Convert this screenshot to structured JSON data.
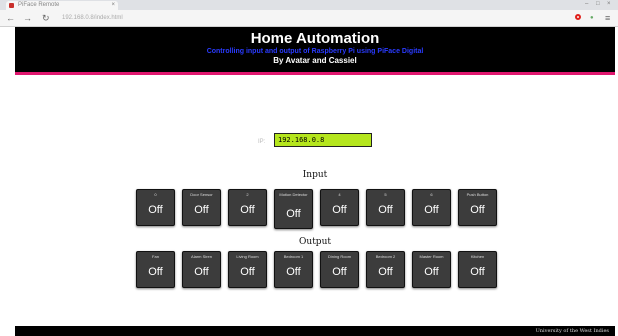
{
  "browser": {
    "tab_title": "PiFace Remote",
    "url": "192.168.0.8/index.html"
  },
  "header": {
    "title": "Home Automation",
    "subtitle": "Controlling input and output of Raspberry Pi using PiFace Digital",
    "authors": "By Avatar and Cassiel"
  },
  "ip": {
    "label": "IP:",
    "value": "192.168.0.8"
  },
  "input": {
    "heading": "Input",
    "items": [
      {
        "label": "0",
        "state": "Off"
      },
      {
        "label": "Door Sensor",
        "state": "Off"
      },
      {
        "label": "2",
        "state": "Off"
      },
      {
        "label": "Motion Detector",
        "state": "Off"
      },
      {
        "label": "4",
        "state": "Off"
      },
      {
        "label": "5",
        "state": "Off"
      },
      {
        "label": "6",
        "state": "Off"
      },
      {
        "label": "Push Button",
        "state": "Off"
      }
    ]
  },
  "output": {
    "heading": "Output",
    "items": [
      {
        "label": "Fan",
        "state": "Off"
      },
      {
        "label": "Alarm Siren",
        "state": "Off"
      },
      {
        "label": "Living Room",
        "state": "Off"
      },
      {
        "label": "Bedroom 1",
        "state": "Off"
      },
      {
        "label": "Dining Room",
        "state": "Off"
      },
      {
        "label": "Bedroom 2",
        "state": "Off"
      },
      {
        "label": "Master Room",
        "state": "Off"
      },
      {
        "label": "Kitchen",
        "state": "Off"
      }
    ]
  },
  "footer": {
    "text": "University of the West Indies"
  },
  "colors": {
    "header_bg": "#000000",
    "accent_line": "#e0176f",
    "subtitle": "#2a3bff",
    "ip_field": "#b5e61d",
    "card_bg": "#3c3c3c"
  }
}
